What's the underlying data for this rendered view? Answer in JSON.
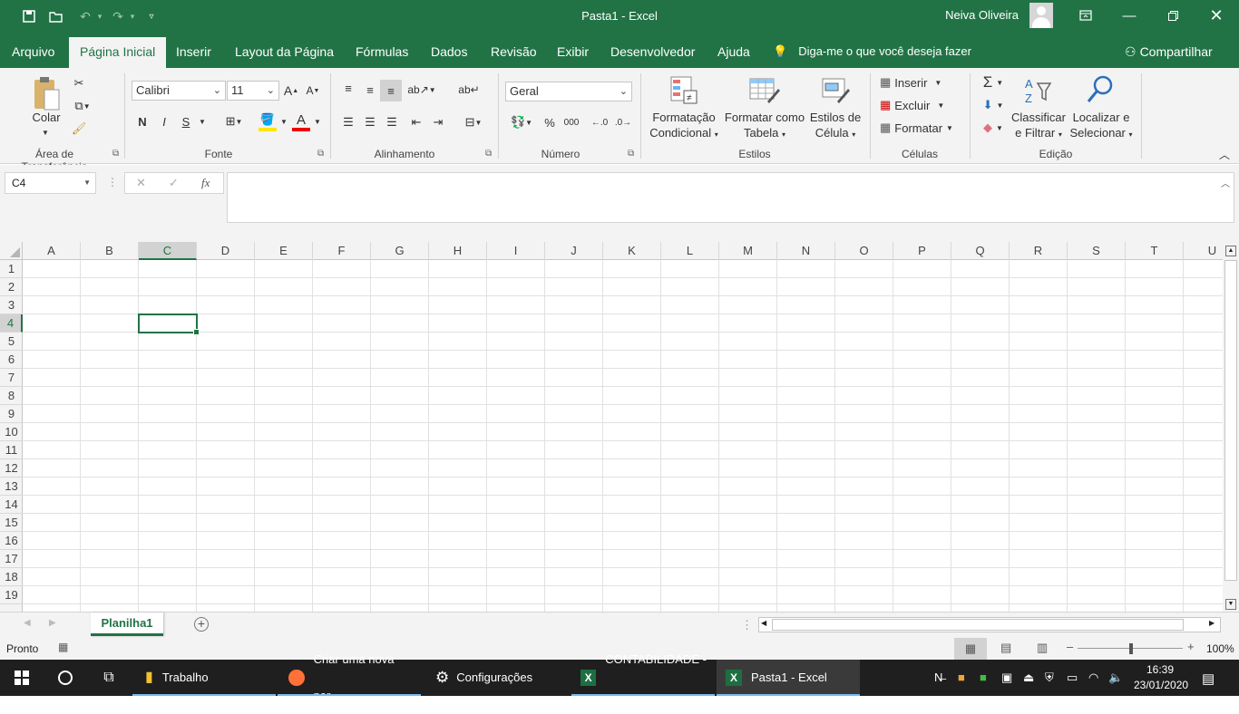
{
  "window": {
    "title": "Pasta1  -  Excel",
    "user": "Neiva Oliveira"
  },
  "tabs": [
    "Arquivo",
    "Página Inicial",
    "Inserir",
    "Layout da Página",
    "Fórmulas",
    "Dados",
    "Revisão",
    "Exibir",
    "Desenvolvedor",
    "Ajuda"
  ],
  "tell_me": "Diga-me o que você deseja fazer",
  "share": "Compartilhar",
  "ribbon": {
    "clipboard": {
      "paste": "Colar",
      "group": "Área de Transferência"
    },
    "font": {
      "name": "Calibri",
      "size": "11",
      "bold": "N",
      "italic": "I",
      "underline": "S",
      "group": "Fonte"
    },
    "alignment": {
      "group": "Alinhamento"
    },
    "number": {
      "format": "Geral",
      "percent": "%",
      "thousands": "000",
      "group": "Número"
    },
    "styles": {
      "cond_line1": "Formatação",
      "cond_line2": "Condicional",
      "table_line1": "Formatar como",
      "table_line2": "Tabela",
      "cell_line1": "Estilos de",
      "cell_line2": "Célula",
      "group": "Estilos"
    },
    "cells": {
      "insert": "Inserir",
      "delete": "Excluir",
      "format": "Formatar",
      "group": "Células"
    },
    "editing": {
      "sort_line1": "Classificar",
      "sort_line2": "e Filtrar",
      "find_line1": "Localizar e",
      "find_line2": "Selecionar",
      "group": "Edição"
    }
  },
  "formula_bar": {
    "name_box": "C4",
    "fx": "fx",
    "value": ""
  },
  "grid": {
    "columns": [
      "A",
      "B",
      "C",
      "D",
      "E",
      "F",
      "G",
      "H",
      "I",
      "J",
      "K",
      "L",
      "M",
      "N",
      "O",
      "P",
      "Q",
      "R",
      "S",
      "T",
      "U"
    ],
    "rows": [
      "1",
      "2",
      "3",
      "4",
      "5",
      "6",
      "7",
      "8",
      "9",
      "10",
      "11",
      "12",
      "13",
      "14",
      "15",
      "16",
      "17",
      "18",
      "19"
    ],
    "active_cell": "C4"
  },
  "sheet": {
    "tab": "Planilha1"
  },
  "status": {
    "mode": "Pronto",
    "zoom": "100%"
  },
  "taskbar": {
    "items": [
      "Trabalho",
      "Criar uma nova per...",
      "Configurações",
      "CONTABILIDADE - ...",
      "Pasta1 - Excel"
    ],
    "time": "16:39",
    "date": "23/01/2020"
  }
}
